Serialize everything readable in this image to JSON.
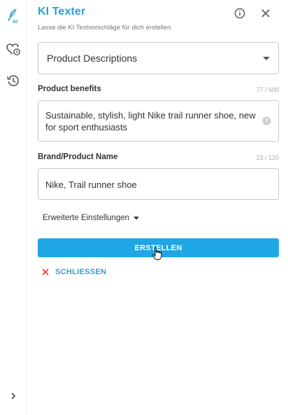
{
  "header": {
    "title": "KI Texter",
    "subtitle": "Lasse die KI Textvorschläge für dich erstellen",
    "info_icon": "info-circle-icon",
    "close_icon": "close-icon"
  },
  "rail": {
    "logo_icon": "feather-ai-icon",
    "logo_badge": "AI",
    "items": [
      "heart-clock-icon",
      "history-icon"
    ],
    "expand_icon": "chevron-right-icon"
  },
  "form": {
    "type_select": {
      "value": "Product Descriptions"
    },
    "benefits": {
      "label": "Product benefits",
      "counter": "77 / 600",
      "value": "Sustainable, stylish, light Nike trail runner shoe, new for sport enthusiasts"
    },
    "brand": {
      "label": "Brand/Product Name",
      "counter": "23 / 120",
      "value": "Nike, Trail runner shoe"
    },
    "advanced_label": "Erweiterte Einstellungen",
    "create_button": "ERSTELLEN",
    "close_label": "SCHLIESSEN"
  },
  "colors": {
    "accent": "#2b9fd8",
    "button": "#1ea7e4",
    "close_x": "#e0444d"
  }
}
